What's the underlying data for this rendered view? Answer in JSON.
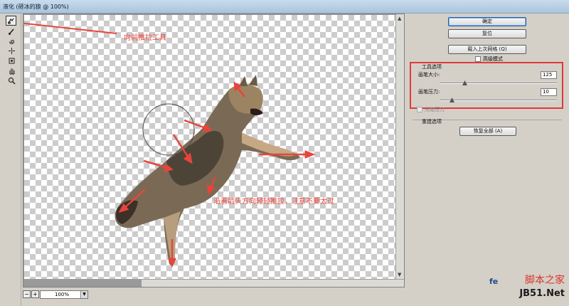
{
  "window": {
    "title": "液化 (砸冰的狼 @ 100%)"
  },
  "tools": [
    {
      "name": "forward-warp-tool",
      "icon": "finger-warp-icon",
      "active": true
    },
    {
      "name": "reconstruct-tool",
      "icon": "brush-icon"
    },
    {
      "name": "twirl-tool",
      "icon": "twirl-icon"
    },
    {
      "name": "pucker-tool",
      "icon": "pucker-icon"
    },
    {
      "name": "bloat-tool",
      "icon": "bloat-icon"
    },
    {
      "name": "hand-tool",
      "icon": "hand-icon"
    },
    {
      "name": "zoom-tool",
      "icon": "magnifier-icon"
    }
  ],
  "buttons": {
    "ok": "确定",
    "reset": "复位",
    "load_last_mesh": "载入上次网格 (Q)",
    "restore_all": "恢复全部 (A)"
  },
  "advanced_mode": {
    "label": "高级模式"
  },
  "tool_options": {
    "header": "工具选项",
    "brush_size_label": "画笔大小:",
    "brush_size": "125",
    "brush_size_fraction": 0.21,
    "brush_pressure_label": "画笔压力:",
    "brush_pressure": "10",
    "brush_pressure_fraction": 0.1,
    "stylus_pressure_label": "光笔压力"
  },
  "reconstruct_options": {
    "header": "重建选项"
  },
  "zoom": {
    "value": "100%",
    "minus": "−",
    "plus": "+"
  },
  "annotations": {
    "tool_hint": "向前推拉工具",
    "usage_hint": "沿着箭头方向轻轻推拉，注意不要太过"
  },
  "watermark": {
    "top": "脚本之家",
    "site": "fe",
    "bottom": "JB51.Net"
  },
  "colors": {
    "annotation": "#e8443c",
    "highlight_box": "#e03a3a",
    "checker": "#cccccc"
  }
}
